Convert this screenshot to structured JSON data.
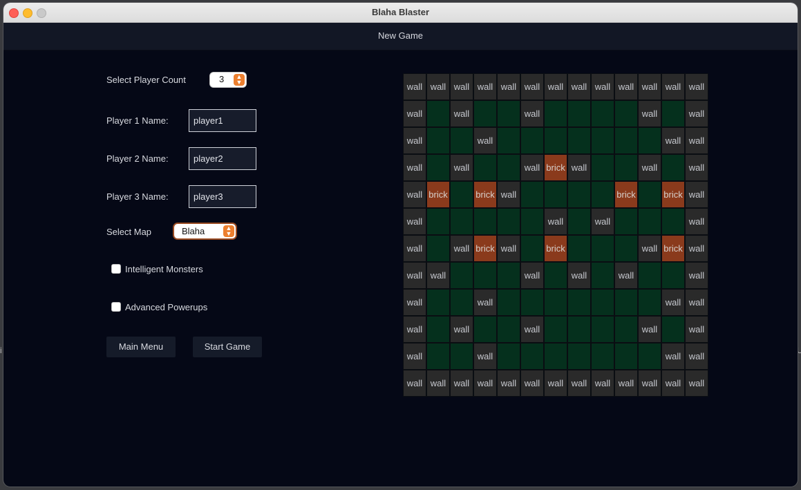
{
  "window": {
    "title": "Blaha Blaster"
  },
  "header": {
    "title": "New Game"
  },
  "player_count": {
    "label": "Select Player Count",
    "value": "3"
  },
  "players": [
    {
      "label": "Player 1 Name:",
      "value": "player1"
    },
    {
      "label": "Player 2 Name:",
      "value": "player2"
    },
    {
      "label": "Player 3 Name:",
      "value": "player3"
    }
  ],
  "map_select": {
    "label": "Select Map",
    "value": "Blaha"
  },
  "options": {
    "intelligent_monsters": {
      "label": "Intelligent Monsters",
      "checked": false
    },
    "advanced_powerups": {
      "label": "Advanced Powerups",
      "checked": false
    }
  },
  "buttons": {
    "main_menu": "Main Menu",
    "start_game": "Start Game"
  },
  "behind_window": {
    "left_char": "i",
    "right_char": "U"
  },
  "colors": {
    "wall": "#2a2a2a",
    "brick": "#8a3a1c",
    "floor": "#05301d",
    "accent": "#ec7f2f"
  },
  "map_legend": {
    "W": "wall",
    "B": "brick",
    ".": ""
  },
  "map_rows": [
    "WWWWWWWWWWWWW",
    "W.W..W....W.W",
    "W..W.......WW",
    "W.W..WBW..W.W",
    "WB.BW....B.BW",
    "W.....W.W...W",
    "W.WBW.B...WBW",
    "WW...W.W.W..W",
    "W..W.......WW",
    "W.W..W....W.W",
    "W..W.......WW",
    "WWWWWWWWWWWWW"
  ]
}
